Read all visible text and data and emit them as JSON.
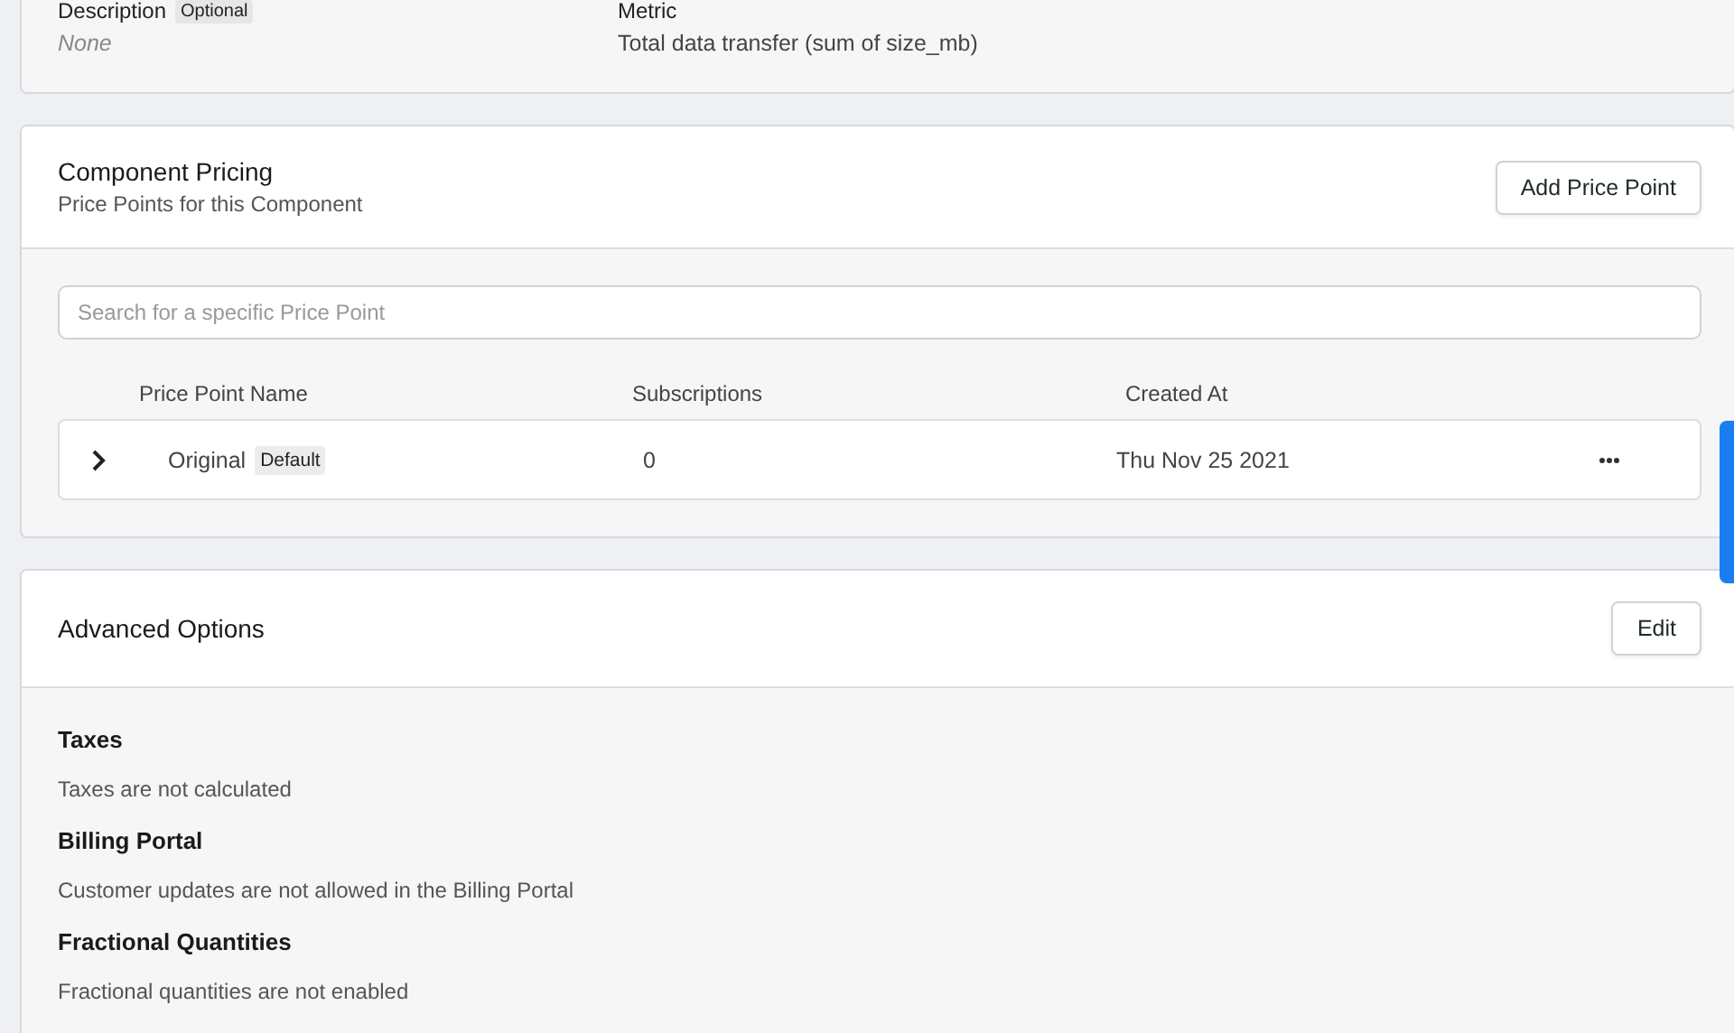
{
  "details": {
    "fields": [
      {
        "label": "Description",
        "badge": "Optional",
        "value": "None",
        "empty": true
      },
      {
        "label": "Metric",
        "value": "Total data transfer (sum of size_mb)",
        "empty": false
      }
    ]
  },
  "pricing": {
    "title": "Component Pricing",
    "subtitle": "Price Points for this Component",
    "button": "Add Price Point",
    "search": {
      "placeholder": "Search for a specific Price Point"
    },
    "columns": [
      "Price Point Name",
      "Subscriptions",
      "Created At"
    ],
    "rows": [
      {
        "name": "Original",
        "badge": "Default",
        "subscriptions": "0",
        "created": "Thu Nov 25 2021",
        "expanded": false
      }
    ]
  },
  "advanced": {
    "title": "Advanced Options",
    "button": "Edit",
    "sections": [
      {
        "title": "Taxes",
        "text": "Taxes are not calculated"
      },
      {
        "title": "Billing Portal",
        "text": "Customer updates are not allowed in the Billing Portal"
      },
      {
        "title": "Fractional Quantities",
        "text": "Fractional quantities are not enabled"
      }
    ]
  }
}
